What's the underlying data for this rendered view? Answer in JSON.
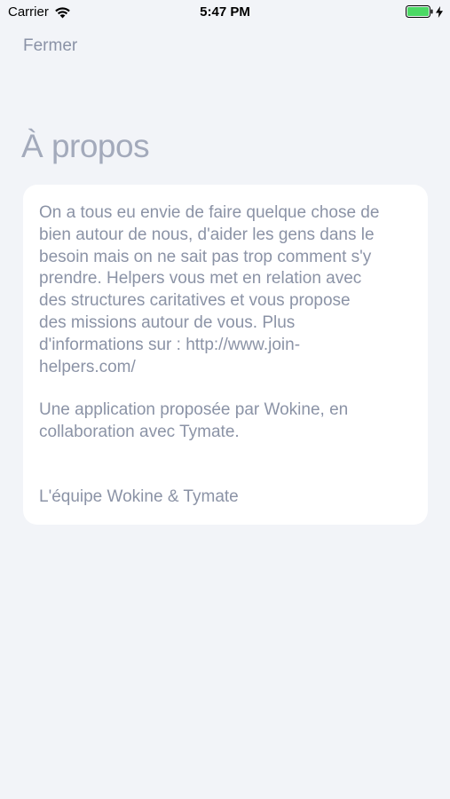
{
  "status_bar": {
    "carrier": "Carrier",
    "time": "5:47 PM",
    "icons": [
      "wifi-icon",
      "battery-icon",
      "charging-bolt-icon"
    ],
    "battery_color": "#4cd964"
  },
  "nav": {
    "close_label": "Fermer"
  },
  "page": {
    "title": "À propos"
  },
  "about": {
    "paragraph_1": "On a tous eu envie de faire quelque chose de\nbien autour de nous, d'aider les gens dans le\nbesoin mais on ne sait pas trop comment s'y\nprendre. Helpers vous met en relation avec\ndes structures caritatives et vous propose\ndes missions autour de vous. Plus\nd'informations sur : http://www.join-\nhelpers.com/",
    "paragraph_2": "Une application proposée par Wokine, en\ncollaboration avec Tymate.",
    "signature": "L'équipe Wokine & Tymate"
  },
  "colors": {
    "background": "#f2f4f8",
    "card": "#ffffff",
    "text": "#8b93a6",
    "title": "#a3aabb"
  }
}
